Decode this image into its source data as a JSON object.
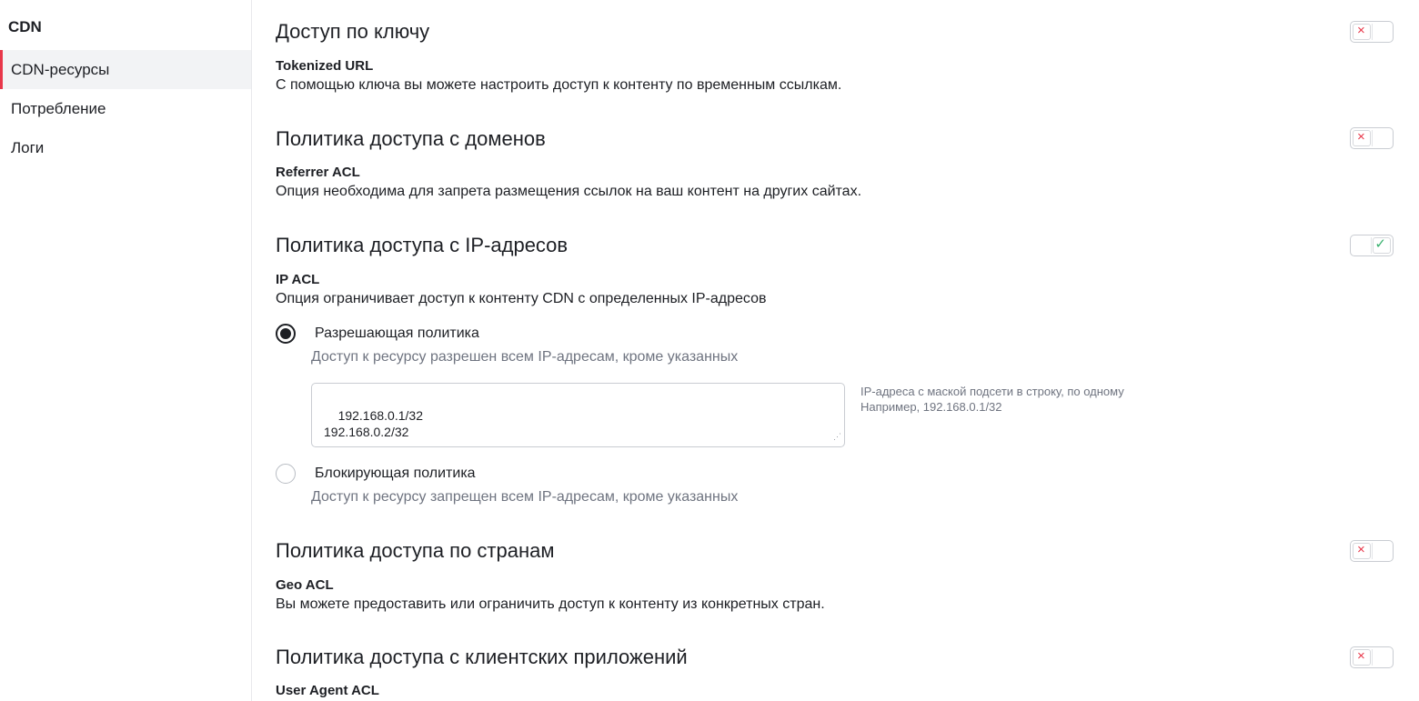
{
  "sidebar": {
    "title": "CDN",
    "items": [
      {
        "label": "CDN-ресурсы",
        "active": true
      },
      {
        "label": "Потребление",
        "active": false
      },
      {
        "label": "Логи",
        "active": false
      }
    ]
  },
  "sections": {
    "token": {
      "title": "Доступ по ключу",
      "subtitle": "Tokenized URL",
      "description": "С помощью ключа вы можете настроить доступ к контенту по временным ссылкам.",
      "enabled": false
    },
    "referrer": {
      "title": "Политика доступа с доменов",
      "subtitle": "Referrer ACL",
      "description": "Опция необходима для запрета размещения ссылок на ваш контент на других сайтах.",
      "enabled": false
    },
    "ip": {
      "title": "Политика доступа с IP-адресов",
      "subtitle": "IP ACL",
      "description": "Опция ограничивает доступ к контенту CDN с определенных IP-адресов",
      "enabled": true,
      "allow_label": "Разрешающая политика",
      "allow_desc": "Доступ к ресурсу разрешен всем IP-адресам, кроме указанных",
      "textarea_value": "192.168.0.1/32\n192.168.0.2/32",
      "hint_line1": "IP-адреса с маской подсети в строку, по одному",
      "hint_line2": "Например, 192.168.0.1/32",
      "deny_label": "Блокирующая политика",
      "deny_desc": "Доступ к ресурсу запрещен всем IP-адресам, кроме указанных",
      "selected": "allow"
    },
    "geo": {
      "title": "Политика доступа по странам",
      "subtitle": "Geo ACL",
      "description": "Вы можете предоставить или ограничить доступ к контенту из конкретных стран.",
      "enabled": false
    },
    "ua": {
      "title": "Политика доступа с клиентских приложений",
      "subtitle": "User Agent ACL",
      "enabled": false
    }
  },
  "icons": {
    "toggle_off": "×",
    "toggle_on": "✓",
    "resize_handle": "⋰"
  },
  "colors": {
    "accent": "#e8374a",
    "success": "#35b06c",
    "text": "#1d1f24",
    "muted": "#6f7480"
  }
}
